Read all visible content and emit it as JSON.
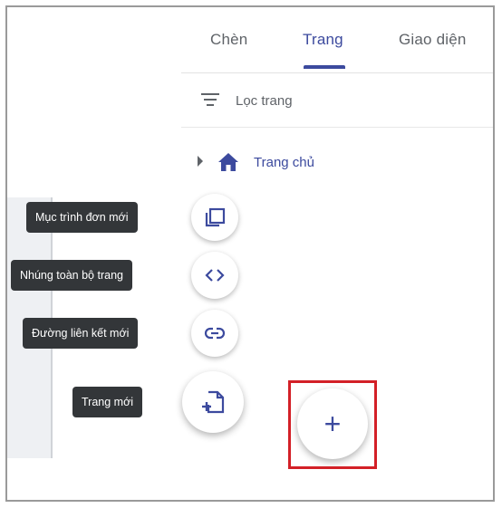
{
  "tabs": [
    {
      "label": "Chèn"
    },
    {
      "label": "Trang"
    },
    {
      "label": "Giao diện"
    }
  ],
  "active_tab": "Trang",
  "filter": {
    "label": "Lọc trang"
  },
  "tree": {
    "home_label": "Trang chủ"
  },
  "fab_menu": {
    "items": [
      {
        "label": "Mục trình đơn mới",
        "icon": "copy-page-icon"
      },
      {
        "label": "Nhúng toàn bộ trang",
        "icon": "code-icon"
      },
      {
        "label": "Đường liên kết mới",
        "icon": "link-icon"
      },
      {
        "label": "Trang mới",
        "icon": "new-page-icon"
      }
    ],
    "main_symbol": "+"
  },
  "colors": {
    "accent": "#3c4a9e",
    "tooltip_bg": "#333639",
    "highlight": "#d32027"
  }
}
